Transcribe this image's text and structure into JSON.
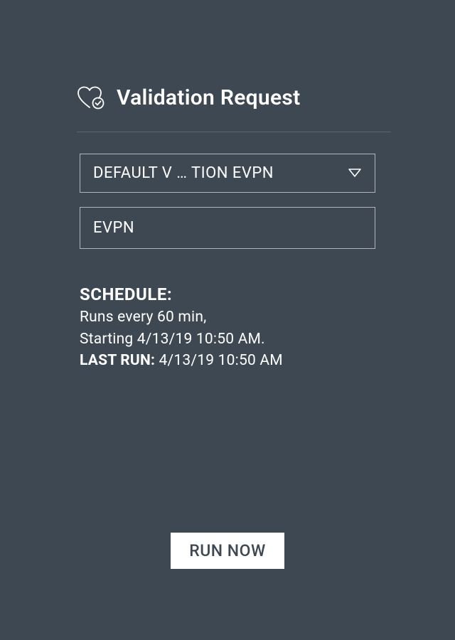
{
  "header": {
    "title": "Validation Request"
  },
  "form": {
    "selection": "DEFAULT V … TION EVPN",
    "inputValue": "EVPN"
  },
  "schedule": {
    "label": "SCHEDULE:",
    "line1": "Runs every 60 min,",
    "line2": "Starting 4/13/19 10:50 AM.",
    "lastRunLabel": "LAST RUN:",
    "lastRunValue": " 4/13/19 10:50 AM"
  },
  "actions": {
    "runNow": "RUN NOW"
  }
}
